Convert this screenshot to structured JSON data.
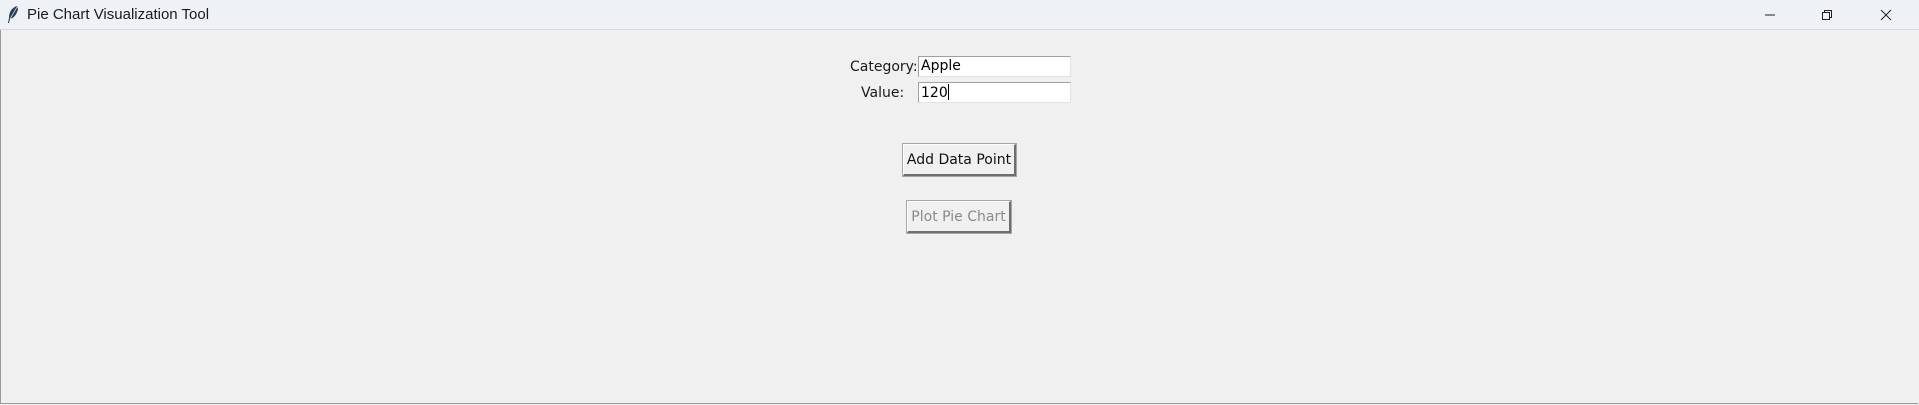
{
  "window": {
    "title": "Pie Chart Visualization Tool",
    "app_icon": "feather-icon",
    "controls": {
      "minimize_icon": "minimize-icon",
      "maximize_icon": "restore-icon",
      "close_icon": "close-icon"
    }
  },
  "form": {
    "category_label": "Category:",
    "category_value": "Apple",
    "value_label": "Value:",
    "value_value": "120"
  },
  "buttons": {
    "add_label": "Add Data Point",
    "plot_label": "Plot Pie Chart",
    "plot_state": "disabled"
  },
  "colors": {
    "window_bg": "#f0f0f0",
    "titlebar_bg": "#eef2f7",
    "disabled_text": "#8a8a8a"
  }
}
